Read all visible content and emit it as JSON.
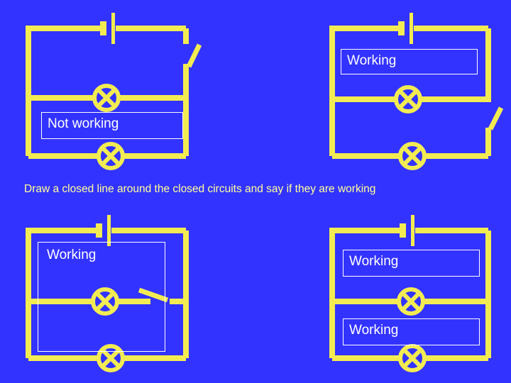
{
  "slide": {
    "background_color": "#3333FF",
    "wire_color": "#F2EC52",
    "label_text_color": "#FFFFFF",
    "label_border_color": "#FFFFFF",
    "instruction_text_color": "#FFFF99",
    "instruction": "Draw a closed line around the closed circuits and say if they are working"
  },
  "circuits": [
    {
      "id": "circuit-top-left",
      "position": "top-left",
      "verdict": "Not working",
      "components": [
        {
          "name": "battery",
          "branch": "top"
        },
        {
          "name": "open-switch",
          "branch": "right-upper-loop",
          "orientation": "vertical-diagonal"
        },
        {
          "name": "lamp",
          "branch": "middle"
        },
        {
          "name": "lamp",
          "branch": "bottom"
        }
      ],
      "labels": [
        {
          "text": "Not working",
          "box": "middle"
        }
      ]
    },
    {
      "id": "circuit-top-right",
      "position": "top-right",
      "verdict": "Working",
      "components": [
        {
          "name": "battery",
          "branch": "top"
        },
        {
          "name": "lamp",
          "branch": "middle"
        },
        {
          "name": "open-switch",
          "branch": "right-lower-loop",
          "orientation": "vertical-diagonal"
        },
        {
          "name": "lamp",
          "branch": "bottom"
        }
      ],
      "labels": [
        {
          "text": "Working",
          "box": "upper"
        }
      ]
    },
    {
      "id": "circuit-bottom-left",
      "position": "bottom-left",
      "verdict": "Working",
      "components": [
        {
          "name": "battery",
          "branch": "top"
        },
        {
          "name": "lamp",
          "branch": "middle"
        },
        {
          "name": "open-switch",
          "branch": "middle",
          "orientation": "horizontal"
        },
        {
          "name": "lamp",
          "branch": "bottom"
        }
      ],
      "labels": [
        {
          "text": "Working",
          "box": "tall"
        }
      ]
    },
    {
      "id": "circuit-bottom-right",
      "position": "bottom-right",
      "verdict": "Working",
      "components": [
        {
          "name": "battery",
          "branch": "top"
        },
        {
          "name": "lamp",
          "branch": "middle"
        },
        {
          "name": "lamp",
          "branch": "bottom"
        }
      ],
      "labels": [
        {
          "text": "Working",
          "box": "upper"
        },
        {
          "text": "Working",
          "box": "lower"
        }
      ]
    }
  ],
  "labels": {
    "tl_middle": "Not working",
    "tr_upper": "Working",
    "bl_tall": "Working",
    "br_upper": "Working",
    "br_lower": "Working"
  }
}
